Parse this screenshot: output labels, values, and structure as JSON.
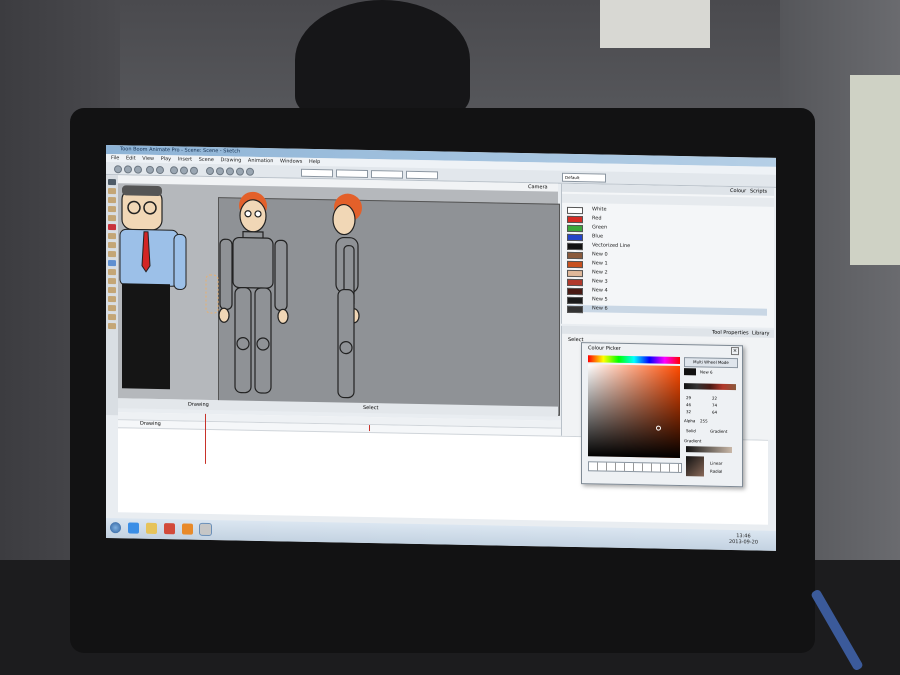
{
  "app": {
    "title": "Toon Boom Animate Pro - Scene: Scene - Sketch",
    "menu": [
      "File",
      "Edit",
      "View",
      "Play",
      "Insert",
      "Scene",
      "Drawing",
      "Animation",
      "Windows",
      "Help"
    ]
  },
  "viewport": {
    "tab_label": "Camera",
    "status_label": "Select",
    "zoom_label": "Drawing"
  },
  "colour_panel": {
    "tabs": [
      "Colour",
      "Scripts"
    ],
    "palette_name": "Default",
    "swatches": [
      {
        "name": "White",
        "color": "#ffffff"
      },
      {
        "name": "Red",
        "color": "#d62b24"
      },
      {
        "name": "Green",
        "color": "#3ba83b"
      },
      {
        "name": "Blue",
        "color": "#2445c9"
      },
      {
        "name": "Vectorized Line",
        "color": "#111111"
      },
      {
        "name": "New 0",
        "color": "#8a5a3c"
      },
      {
        "name": "New 1",
        "color": "#c8501e"
      },
      {
        "name": "New 2",
        "color": "#e0b89a"
      },
      {
        "name": "New 3",
        "color": "#b2392c"
      },
      {
        "name": "New 4",
        "color": "#4a1a14"
      },
      {
        "name": "New 5",
        "color": "#1a1a1a"
      },
      {
        "name": "New 6",
        "color": "#333333"
      }
    ],
    "selected_index": 11
  },
  "tool_properties": {
    "tabs": [
      "Tool Properties",
      "Library"
    ],
    "mode_label": "Select"
  },
  "colour_picker": {
    "title": "Colour Picker",
    "mode_button": "Multi Wheel Mode",
    "swatch_name": "New 6",
    "alpha_label": "Alpha",
    "alpha_value": "255",
    "rgb_values": [
      "29",
      "46",
      "32",
      "22",
      "74",
      "64"
    ],
    "fill_options": [
      "Solid",
      "Gradient"
    ],
    "fill_selected": "Gradient",
    "gradient_label": "Gradient",
    "gradient_types": [
      "Linear",
      "Radial"
    ]
  },
  "timeline": {
    "layer_name": "Drawing"
  },
  "taskbar": {
    "time": "13:46",
    "date": "2013-09-20"
  }
}
